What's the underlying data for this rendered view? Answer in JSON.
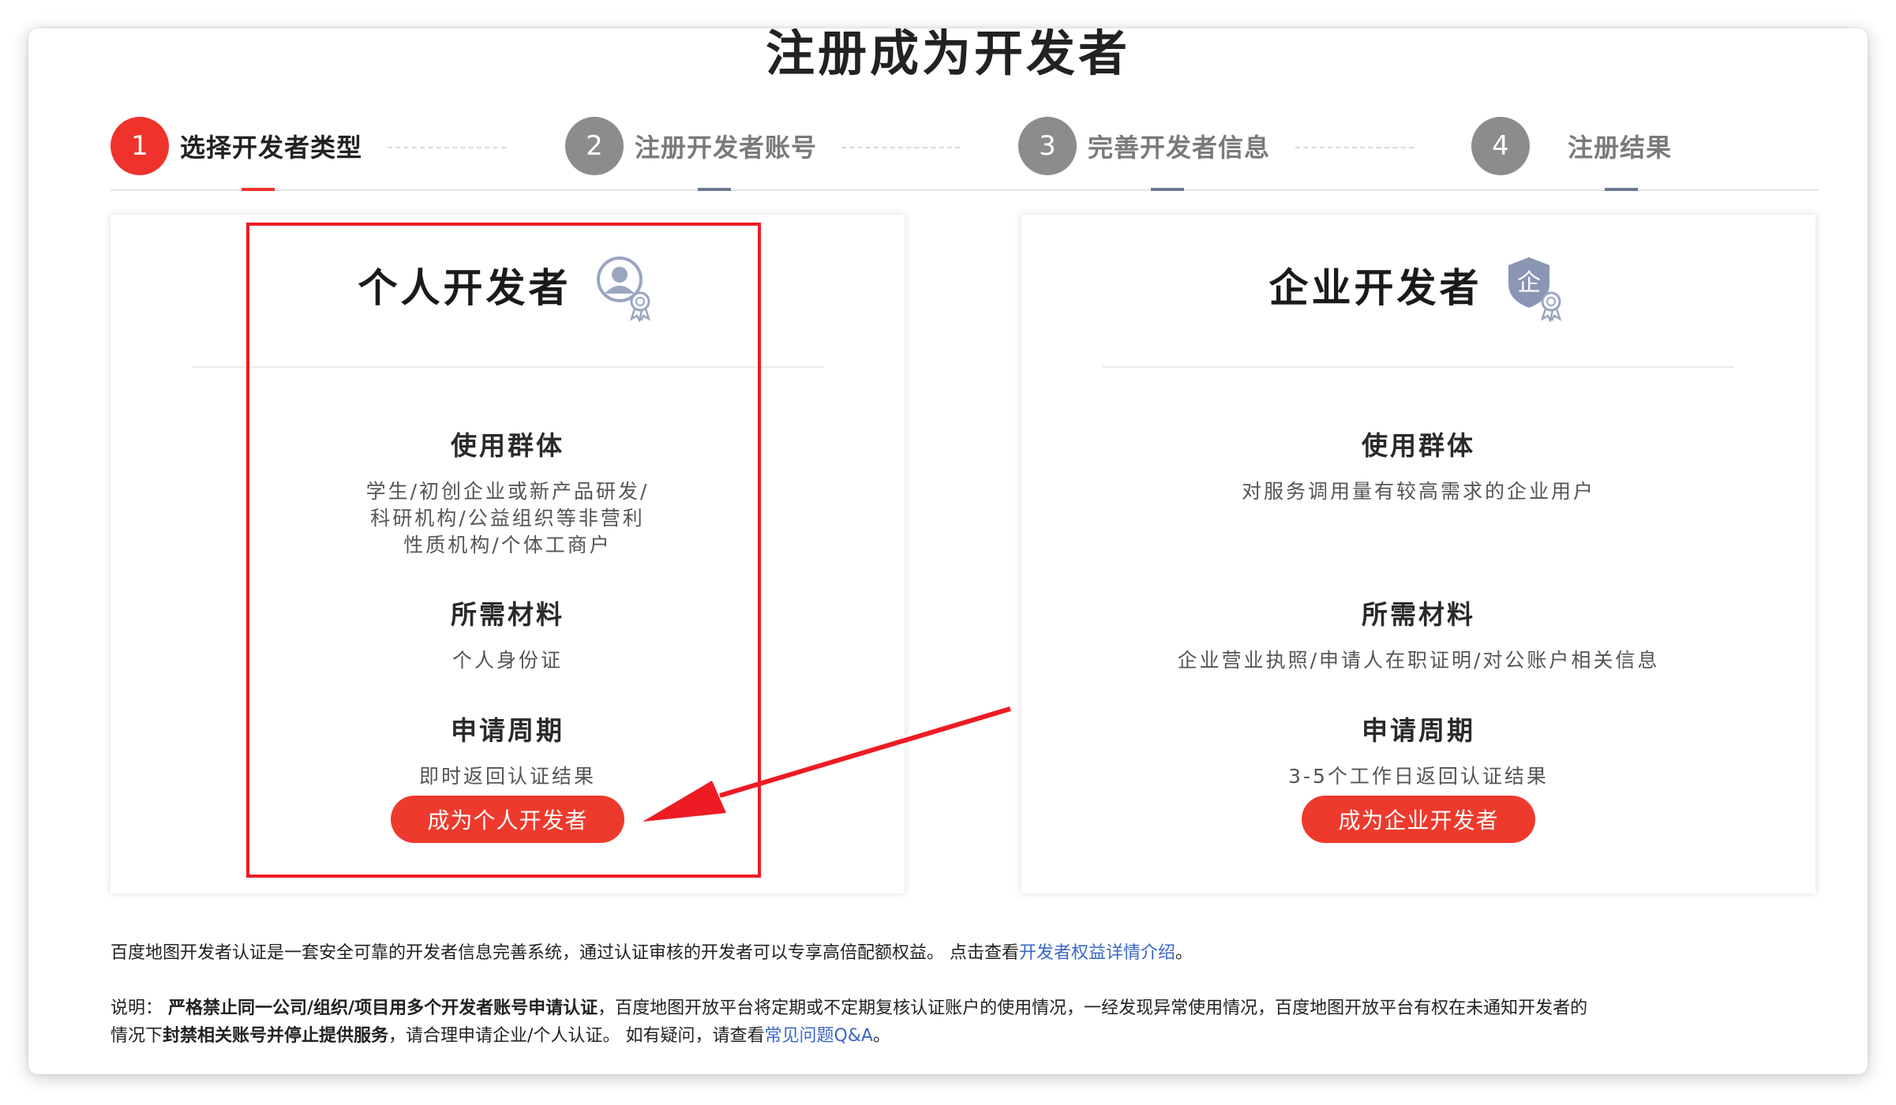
{
  "page": {
    "title": "注册成为开发者"
  },
  "steps": [
    {
      "number": "1",
      "label": "选择开发者类型",
      "active": true
    },
    {
      "number": "2",
      "label": "注册开发者账号",
      "active": false
    },
    {
      "number": "3",
      "label": "完善开发者信息",
      "active": false
    },
    {
      "number": "4",
      "label": "注册结果",
      "active": false
    }
  ],
  "personal": {
    "title": "个人开发者",
    "icon": "personal-certified-icon",
    "sections": [
      {
        "heading": "使用群体",
        "lines": [
          "学生/初创企业或新产品研发/",
          "科研机构/公益组织等非营利",
          "性质机构/个体工商户"
        ]
      },
      {
        "heading": "所需材料",
        "lines": [
          "个人身份证"
        ]
      },
      {
        "heading": "申请周期",
        "lines": [
          "即时返回认证结果"
        ]
      }
    ],
    "button": "成为个人开发者"
  },
  "enterprise": {
    "title": "企业开发者",
    "icon": "enterprise-shield-icon",
    "icon_glyph": "企",
    "sections": [
      {
        "heading": "使用群体",
        "lines": [
          "对服务调用量有较高需求的企业用户"
        ]
      },
      {
        "heading": "所需材料",
        "lines": [
          "企业营业执照/申请人在职证明/对公账户相关信息"
        ]
      },
      {
        "heading": "申请周期",
        "lines": [
          "3-5个工作日返回认证结果"
        ]
      }
    ],
    "button": "成为企业开发者"
  },
  "footer": {
    "intro_text": "百度地图开发者认证是一套安全可靠的开发者信息完善系统，通过认证审核的开发者可以专享高倍配额权益。 点击查看",
    "intro_link": "开发者权益详情介绍",
    "intro_end": "。",
    "note_label": "说明：",
    "note_bold": "严格禁止同一公司/组织/项目用多个开发者账号申请认证",
    "note_mid": "，百度地图开放平台将定期或不定期复核认证账户的使用情况，一经发现异常使用情况，百度地图开放平台有权在未通知开发者的",
    "note_line2_start": "情况下",
    "note_bold2": "封禁相关账号并停止提供服务",
    "note_line2_mid": "，请合理申请企业/个人认证。 如有疑问，请查看",
    "note_link": "常见问题Q&A",
    "note_end": "。"
  },
  "colors": {
    "accent_red": "#f0322d",
    "button_red": "#ee3a2d",
    "step_gray": "#8c8c8c",
    "link_blue": "#3b67c6",
    "annotation_red": "#ee1b24"
  }
}
